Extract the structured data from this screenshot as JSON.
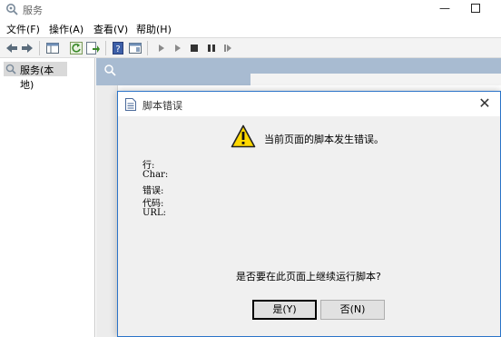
{
  "window": {
    "title": "服务",
    "icon": "services-gear-icon"
  },
  "menu": [
    "文件(F)",
    "操作(A)",
    "查看(V)",
    "帮助(H)"
  ],
  "toolbar": {
    "icons": [
      "back-arrow-icon",
      "forward-arrow-icon",
      "console-tree-icon",
      "refresh-icon",
      "export-list-icon",
      "help-icon",
      "show-hide-pane-icon",
      "play-icon",
      "play-outline-icon",
      "stop-icon",
      "pause-icon",
      "restart-icon"
    ]
  },
  "tree": {
    "label": "服务(本地)"
  },
  "dialog": {
    "title": "脚本错误",
    "message": "当前页面的脚本发生错误。",
    "fields": [
      "行:",
      "Char:",
      "错误:",
      "代码:",
      "URL:"
    ],
    "question": "是否要在此页面上继续运行脚本?",
    "yes_label": "是(Y)",
    "no_label": "否(N)"
  },
  "colors": {
    "dialog_border": "#2a73c8",
    "pane_header": "#a8bbd1",
    "warning_yellow": "#ffd800"
  }
}
